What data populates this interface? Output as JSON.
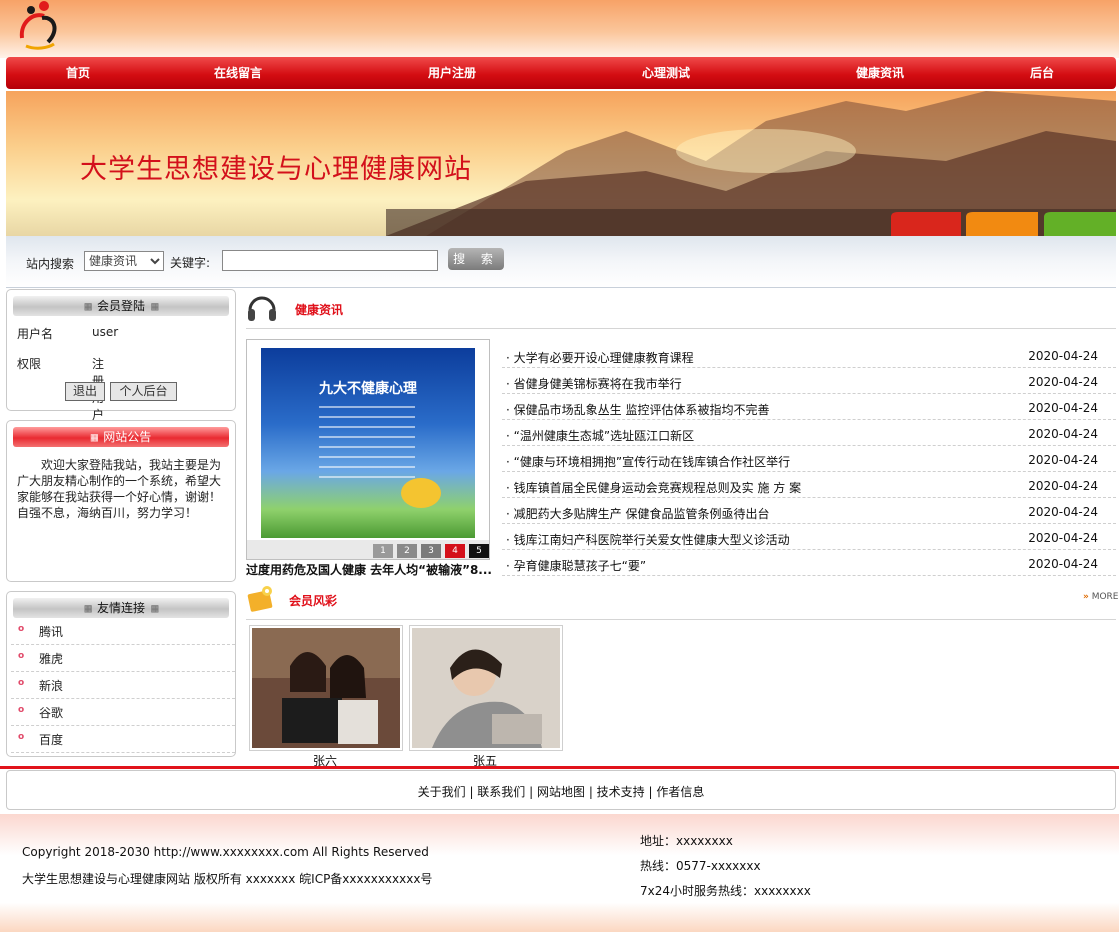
{
  "nav": [
    "首页",
    "在线留言",
    "用户注册",
    "心理测试",
    "健康资讯",
    "后台"
  ],
  "banner": {
    "title": "大学生思想建设与心理健康网站"
  },
  "search": {
    "label": "站内搜索",
    "category": "健康资讯",
    "keyword_label": "关键字:",
    "keyword_value": "",
    "button": "搜 索"
  },
  "login_box": {
    "title": "会员登陆",
    "user_label": "用户名",
    "user_value": "user",
    "role_label": "权限",
    "role_value": "注册用户",
    "logout": "退出",
    "backend": "个人后台"
  },
  "notice_box": {
    "title": "网站公告",
    "text": "　　欢迎大家登陆我站，我站主要是为广大朋友精心制作的一个系统，希望大家能够在我站获得一个好心情，谢谢！　　自强不息，海纳百川，努力学习！"
  },
  "links_box": {
    "title": "友情连接",
    "items": [
      "腾讯",
      "雅虎",
      "新浪",
      "谷歌",
      "百度"
    ]
  },
  "news": {
    "section_title": "健康资讯",
    "featured_caption": "过度用药危及国人健康 去年人均“被输液”8...",
    "featured_pages": [
      "1",
      "2",
      "3",
      "4",
      "5"
    ],
    "poster_text": "九大不健康心理",
    "items": [
      {
        "title": "大学有必要开设心理健康教育课程",
        "date": "2020-04-24"
      },
      {
        "title": "省健身健美锦标赛将在我市举行",
        "date": "2020-04-24"
      },
      {
        "title": "保健品市场乱象丛生 监控评估体系被指均不完善",
        "date": "2020-04-24"
      },
      {
        "title": "“温州健康生态城”选址瓯江口新区",
        "date": "2020-04-24"
      },
      {
        "title": "“健康与环境相拥抱”宣传行动在钱库镇合作社区举行",
        "date": "2020-04-24"
      },
      {
        "title": "钱库镇首届全民健身运动会竞赛规程总则及实 施 方 案",
        "date": "2020-04-24"
      },
      {
        "title": "减肥药大多贴牌生产 保健食品监管条例亟待出台",
        "date": "2020-04-24"
      },
      {
        "title": "钱库江南妇产科医院举行关爱女性健康大型义诊活动",
        "date": "2020-04-24"
      },
      {
        "title": "孕育健康聪慧孩子七“要”",
        "date": "2020-04-24"
      }
    ]
  },
  "members": {
    "section_title": "会员风彩",
    "more": "MORE",
    "items": [
      {
        "name": "张六"
      },
      {
        "name": "张五"
      }
    ]
  },
  "footer": {
    "links": [
      "关于我们",
      "联系我们",
      "网站地图",
      "技术支持",
      "作者信息"
    ],
    "copyright": "Copyright 2018-2030 http://www.xxxxxxxx.com All Rights Reserved",
    "owner": "大学生思想建设与心理健康网站 版权所有 xxxxxxx 皖ICP备xxxxxxxxxxx号",
    "address": "地址：xxxxxxxx",
    "hotline": "热线：0577-xxxxxxx",
    "service": "7x24小时服务热线：xxxxxxxx"
  },
  "colors": {
    "brand_red": "#d40d12",
    "title_red": "#e0101a",
    "banner_orange": "#f6a35c"
  }
}
